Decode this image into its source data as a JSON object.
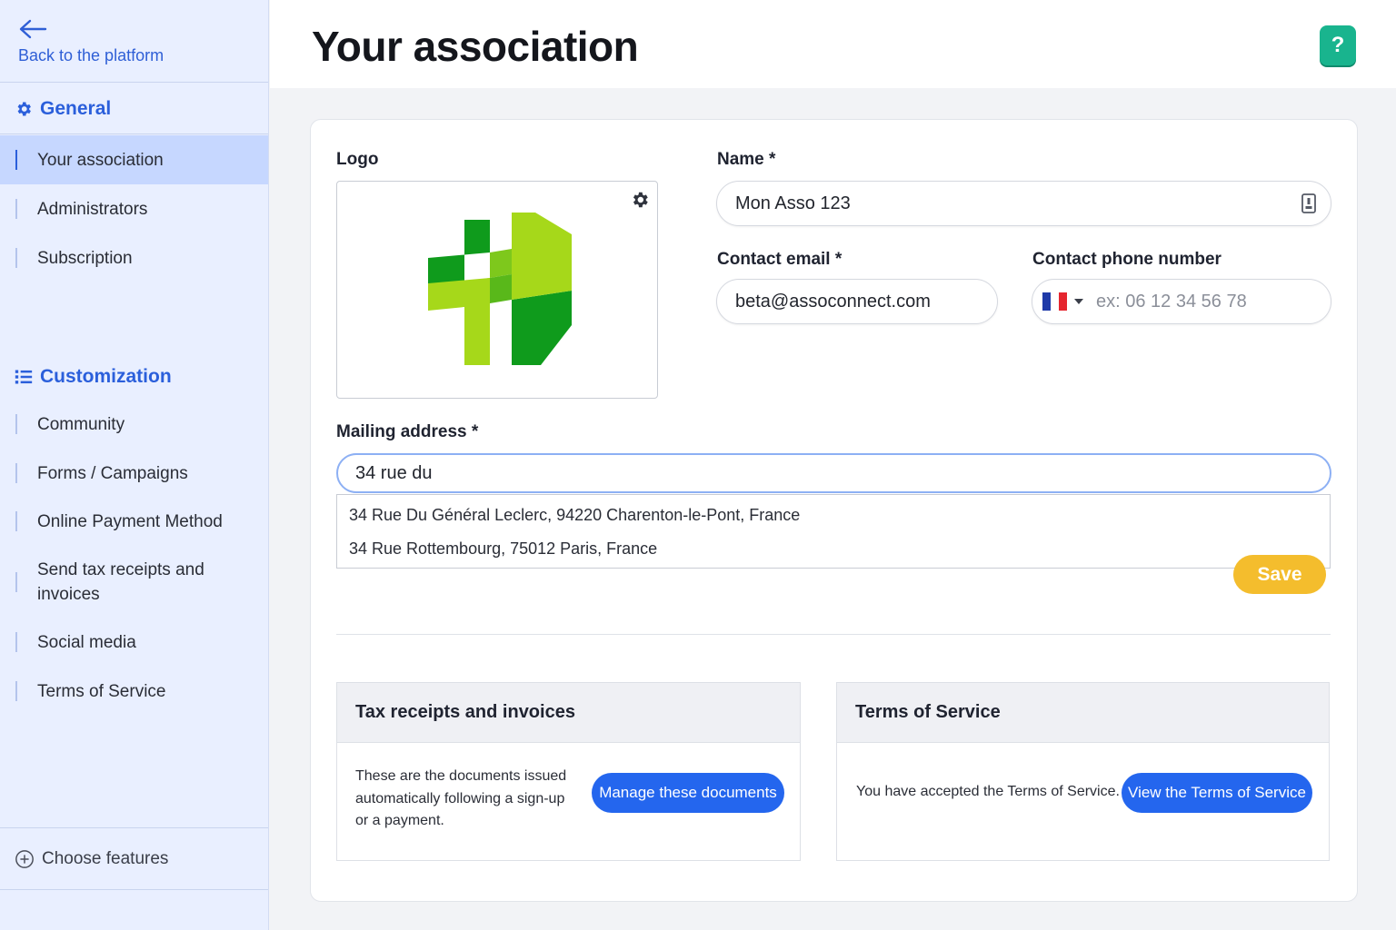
{
  "sidebar": {
    "back_label": "Back to the platform",
    "general": {
      "title": "General",
      "items": [
        {
          "label": "Your association"
        },
        {
          "label": "Administrators"
        },
        {
          "label": "Subscription"
        }
      ]
    },
    "customization": {
      "title": "Customization",
      "items": [
        {
          "label": "Community"
        },
        {
          "label": "Forms / Campaigns"
        },
        {
          "label": "Online Payment Method"
        },
        {
          "label": "Send tax receipts and invoices"
        },
        {
          "label": "Social media"
        },
        {
          "label": "Terms of Service"
        }
      ]
    },
    "choose_features": "Choose features",
    "active_item": "Your association"
  },
  "header": {
    "title": "Your association",
    "help_label": "?"
  },
  "form": {
    "logo_label": "Logo",
    "name_label": "Name *",
    "name_value": "Mon Asso 123",
    "email_label": "Contact email *",
    "email_value": "beta@assoconnect.com",
    "phone_label": "Contact phone number",
    "phone_placeholder": "ex: 06 12 34 56 78",
    "address_label": "Mailing address *",
    "address_value": "34 rue du",
    "suggestions": [
      "34 Rue Du Général Leclerc, 94220 Charenton-le-Pont, France",
      "34 Rue Rottembourg, 75012 Paris, France"
    ],
    "save_label": "Save"
  },
  "panels": {
    "tax": {
      "title": "Tax receipts and invoices",
      "text_lines": [
        "These are the documents issued",
        "automatically following a sign-up",
        "or a payment."
      ],
      "button": "Manage these documents"
    },
    "tos": {
      "title": "Terms of Service",
      "text": "You have accepted the Terms of Service.",
      "button": "View the Terms of Service"
    }
  },
  "colors": {
    "accent_blue": "#2b5fdb",
    "button_blue": "#2466ee",
    "save_yellow": "#f4bd2d",
    "help_green": "#19b48e",
    "sidebar_bg": "#e9efff"
  }
}
